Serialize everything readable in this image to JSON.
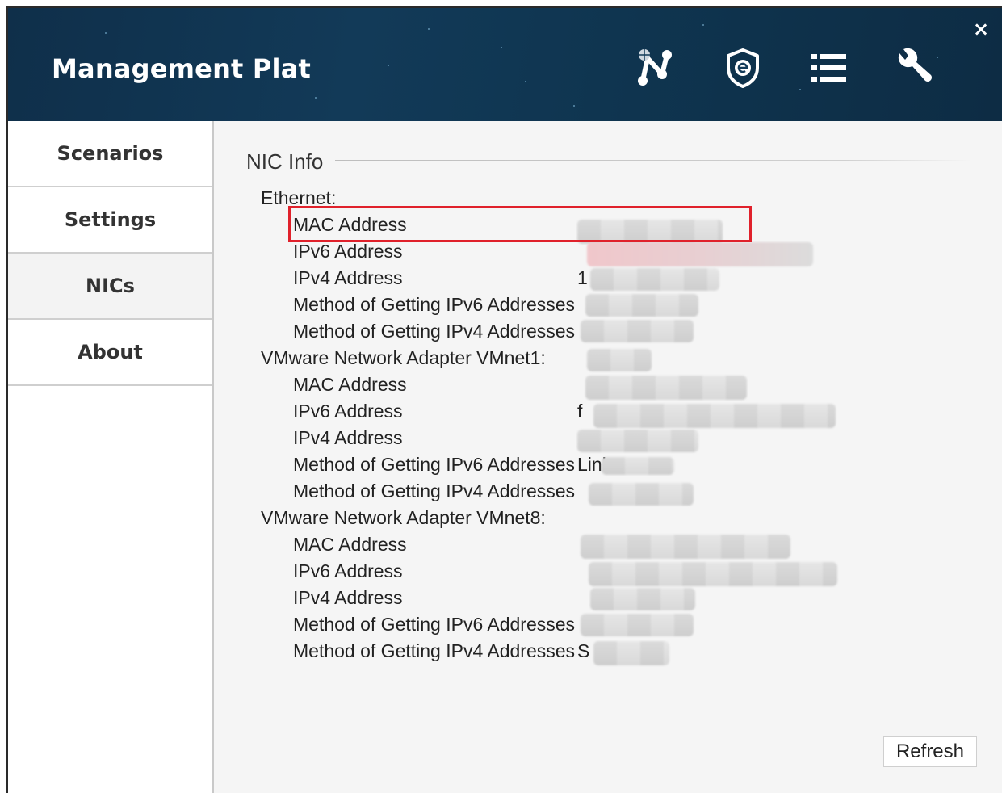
{
  "header": {
    "title": "Management Plat",
    "icons": [
      "network-topology-icon",
      "shield-e-icon",
      "list-icon",
      "wrench-icon"
    ],
    "close_label": "×"
  },
  "sidebar": {
    "items": [
      {
        "label": "Scenarios",
        "active": false
      },
      {
        "label": "Settings",
        "active": false
      },
      {
        "label": "NICs",
        "active": true
      },
      {
        "label": "About",
        "active": false
      }
    ]
  },
  "main": {
    "section_title": "NIC Info",
    "adapters": [
      {
        "name": "Ethernet:",
        "fields": [
          {
            "label": "MAC Address",
            "value": ""
          },
          {
            "label": "IPv6 Address",
            "value": ""
          },
          {
            "label": "IPv4 Address",
            "value": "1"
          },
          {
            "label": "Method of Getting IPv6 Addresses",
            "value": ""
          },
          {
            "label": "Method of Getting IPv4 Addresses",
            "value": ""
          }
        ]
      },
      {
        "name": "VMware Network Adapter VMnet1:",
        "fields": [
          {
            "label": "MAC Address",
            "value": ""
          },
          {
            "label": "IPv6 Address",
            "value": "f"
          },
          {
            "label": "IPv4 Address",
            "value": ""
          },
          {
            "label": "Method of Getting IPv6 Addresses",
            "value": "Linl"
          },
          {
            "label": "Method of Getting IPv4 Addresses",
            "value": ""
          }
        ]
      },
      {
        "name": "VMware Network Adapter VMnet8:",
        "fields": [
          {
            "label": "MAC Address",
            "value": ""
          },
          {
            "label": "IPv6 Address",
            "value": ""
          },
          {
            "label": "IPv4 Address",
            "value": ""
          },
          {
            "label": "Method of Getting IPv6 Addresses",
            "value": ""
          },
          {
            "label": "Method of Getting IPv4 Addresses",
            "value": "S"
          }
        ]
      }
    ],
    "refresh_label": "Refresh"
  },
  "colors": {
    "header_bg": "#123a58",
    "highlight": "#e0212b",
    "text": "#222222"
  }
}
